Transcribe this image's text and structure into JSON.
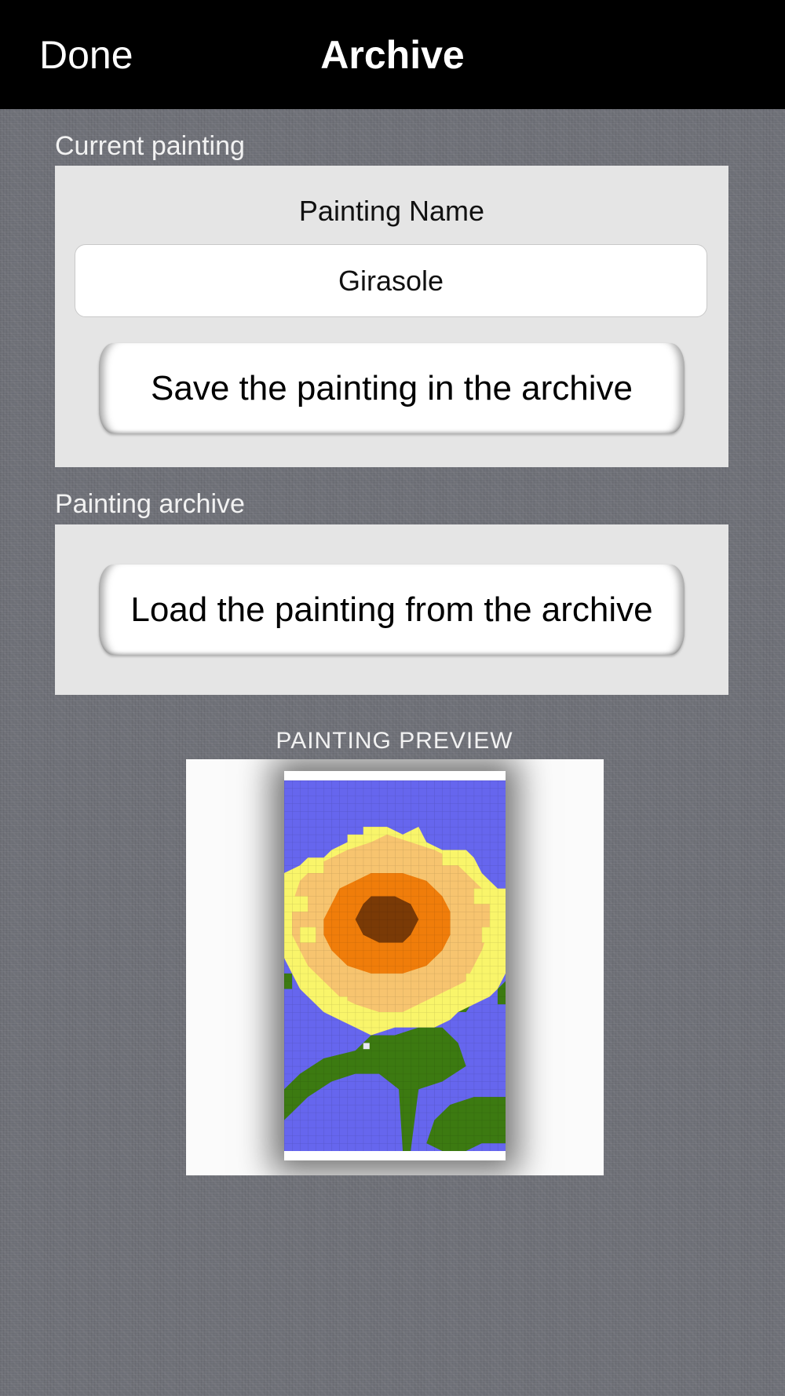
{
  "navbar": {
    "done_label": "Done",
    "title": "Archive"
  },
  "current_section": {
    "label": "Current painting",
    "field_caption": "Painting Name",
    "name_value": "Girasole",
    "save_button_label": "Save the painting in the archive"
  },
  "archive_section": {
    "label": "Painting archive",
    "load_button_label": "Load the painting from the archive"
  },
  "preview": {
    "label": "PAINTING PREVIEW",
    "image_description_icon": "sunflower-pixel-art",
    "colors": {
      "sky": "#6666ee",
      "petal_light": "#f9f56a",
      "petal_dark": "#f7c46f",
      "ring": "#f07d0a",
      "center": "#7a3a06",
      "leaf": "#3c7a11"
    }
  }
}
